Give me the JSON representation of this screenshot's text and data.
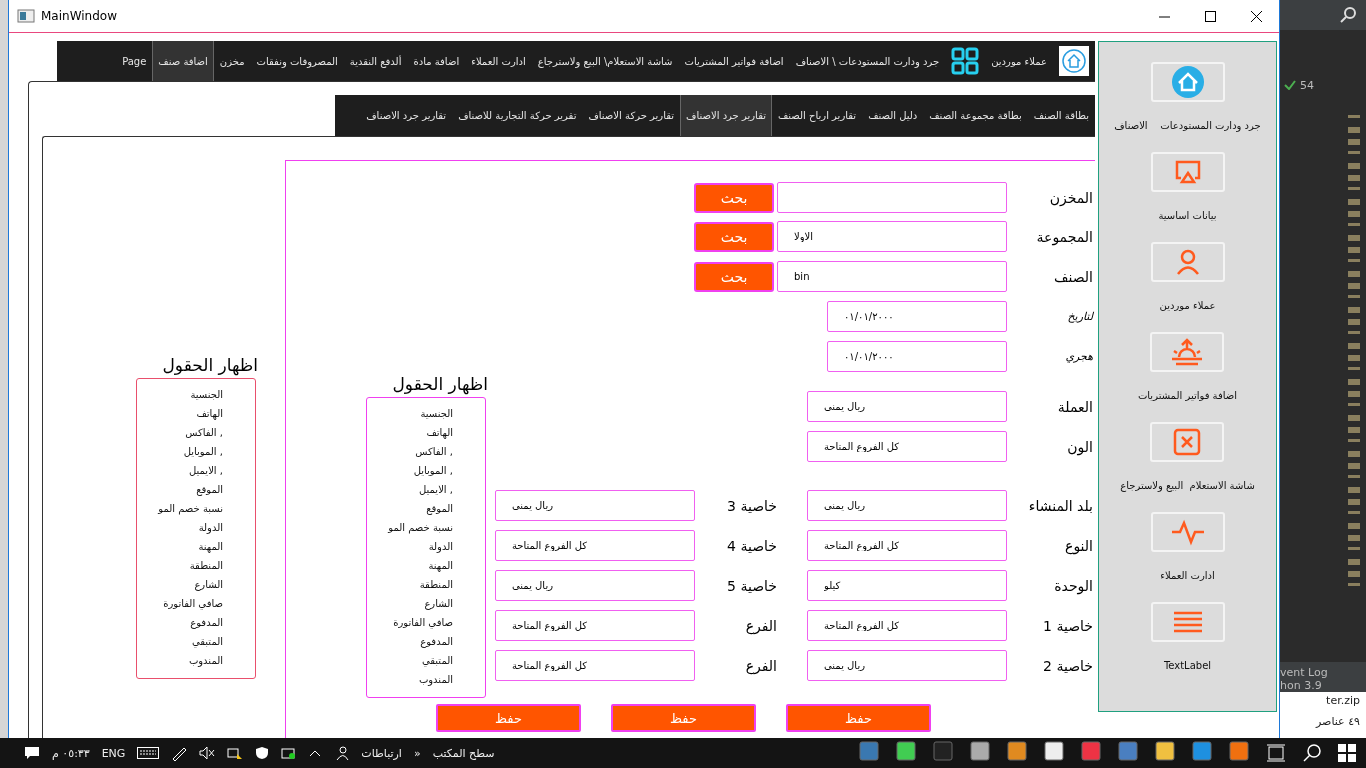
{
  "window": {
    "title": "MainWindow"
  },
  "nav_tabs": [
    {
      "kind": "home",
      "selected": false
    },
    {
      "kind": "text",
      "label": "عملاء موردين",
      "selected": false
    },
    {
      "kind": "grid",
      "selected": false
    },
    {
      "kind": "text",
      "label": "جرد ودارت المستودعات \\ الاصناف",
      "selected": false
    },
    {
      "kind": "text",
      "label": "اضافة فواتير المشتريات",
      "selected": false
    },
    {
      "kind": "text",
      "label": "شاشة الاستعلام\\ البيع ولاسترجاع",
      "selected": false
    },
    {
      "kind": "text",
      "label": "ادارت العملاء",
      "selected": false
    },
    {
      "kind": "text",
      "label": "اضافة مادة",
      "selected": false
    },
    {
      "kind": "text",
      "label": "ألدفع النقدية",
      "selected": false
    },
    {
      "kind": "text",
      "label": "المصروفات ونفقات",
      "selected": false
    },
    {
      "kind": "text",
      "label": "مخزن",
      "selected": false
    },
    {
      "kind": "text",
      "label": "اضافة صنف",
      "selected": true
    },
    {
      "kind": "text",
      "label": "Page",
      "selected": false
    }
  ],
  "sub_tabs": [
    {
      "label": "بطاقة الصنف",
      "selected": false
    },
    {
      "label": "بطاقة مجموعة الصنف",
      "selected": false
    },
    {
      "label": "دليل الصنف",
      "selected": false
    },
    {
      "label": "تقارير ارباح الصنف",
      "selected": false
    },
    {
      "label": "تقارير جرد الاصناف",
      "selected": true
    },
    {
      "label": "تقارير حركة الاصناف",
      "selected": false
    },
    {
      "label": "تقرير حركة التجارية للاصناف",
      "selected": false
    },
    {
      "label": "تقارير جرد الاصناف",
      "selected": false
    }
  ],
  "left_fields": {
    "heading": "اظهار الحقول",
    "items": [
      "الجنسية",
      "الهاتف",
      "الفاكس ,",
      "الموبايل ,",
      "الايميل ,",
      "الموقع",
      "نسبة خصم المو",
      "الدولة",
      "المهنة",
      "المنطقة",
      "الشارع",
      "صافي الفاتورة",
      "المدفوع",
      "المتبقي",
      "المندوب"
    ]
  },
  "middle_fields": {
    "heading": "اظهار الحقول",
    "items": [
      "الجنسية",
      "الهاتف",
      "الفاكس ,",
      "الموبايل ,",
      "الايميل ,",
      "الموقع",
      "نسبة خصم المو",
      "الدولة",
      "المهنة",
      "المنطقة",
      "الشارع",
      "صافي الفاتورة",
      "المدفوع",
      "المتبقي",
      "المندوب"
    ]
  },
  "main_fields": [
    {
      "kind": "search",
      "label": "المخزن",
      "button": "بحث"
    },
    {
      "kind": "search",
      "label": "المجموعة",
      "value": "الاولا",
      "button": "بحث"
    },
    {
      "kind": "search",
      "label": "الصنف",
      "value": "bin",
      "button": "بحث"
    },
    {
      "kind": "date",
      "label": "لتاريخ",
      "value": "٠١/٠١/٢٠٠٠"
    },
    {
      "kind": "date",
      "label": "هجري",
      "value": "٠١/٠١/٢٠٠٠"
    },
    {
      "kind": "text",
      "label": "العملة",
      "value": "ريال يمني"
    },
    {
      "kind": "text",
      "label": "الون",
      "value": "كل الفروع المتاحة"
    },
    {
      "kind": "text",
      "label": "بلد المنشاء",
      "value": "ريال يمني"
    },
    {
      "kind": "text",
      "label": "النوع",
      "value": "كل الفروع المتاحة"
    },
    {
      "kind": "text",
      "label": "الوحدة",
      "value": "كيلو"
    },
    {
      "kind": "text",
      "label": "خاصية 1",
      "value": "كل الفروع المتاحة"
    },
    {
      "kind": "text",
      "label": "خاصية 2",
      "value": "ريال يمني"
    }
  ],
  "properties": [
    {
      "label": "خاصية 3",
      "value": "ريال يمني"
    },
    {
      "label": "خاصية 4",
      "value": "كل الفروع المتاحة"
    },
    {
      "label": "خاصية 5",
      "value": "ريال يمني"
    },
    {
      "label": "الفرع",
      "value": "كل الفروع المتاحة"
    },
    {
      "label": "الفرع",
      "value": "كل الفروع المتاحة"
    }
  ],
  "save_buttons": [
    "حفظ",
    "حفظ",
    "حفظ"
  ],
  "sidebar": [
    {
      "kind": "home",
      "label": "جرد ودارت المستودعات    الاصناف"
    },
    {
      "kind": "cast",
      "label": "بيانات اساسية"
    },
    {
      "kind": "person",
      "label": "عملاء موردين"
    },
    {
      "kind": "sunrise",
      "label": "اضافة فواتير المشتريات"
    },
    {
      "kind": "xbox",
      "label": "شاشة الاستعلام  البيع ولاسترجاع"
    },
    {
      "kind": "pulse",
      "label": "ادارت العملاء"
    },
    {
      "kind": "menu",
      "label": "TextLabel"
    }
  ],
  "ide": {
    "count": "54",
    "event_log": "vent Log",
    "interpreter": "hon 3.9",
    "file": "ter.zip",
    "items": "٤٩ عناصر"
  },
  "taskbar": {
    "time": "٠٥:٣٣ م",
    "language": "ENG",
    "links": "ارتباطات",
    "chevron": "»",
    "desktop": "سطح المكتب"
  }
}
